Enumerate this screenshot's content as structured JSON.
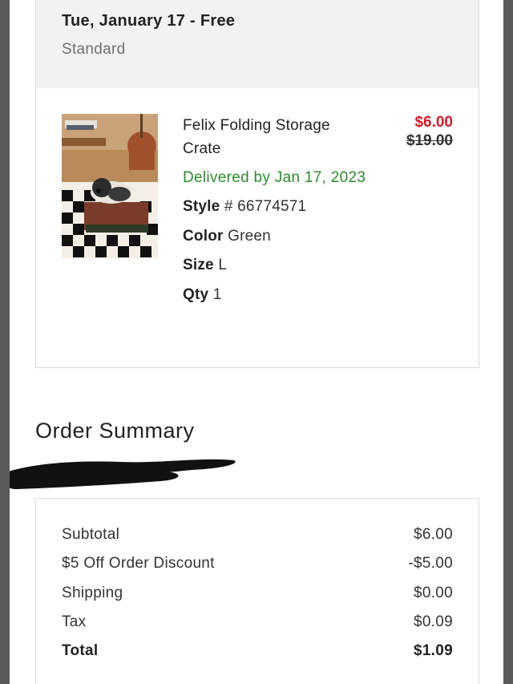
{
  "shipping": {
    "date_label": "Tue, January 17 - Free",
    "method": "Standard"
  },
  "item": {
    "name": "Felix Folding Storage Crate",
    "delivery": "Delivered by Jan 17, 2023",
    "style_label": "Style",
    "style_value": "# 66774571",
    "color_label": "Color",
    "color_value": "Green",
    "size_label": "Size",
    "size_value": "L",
    "qty_label": "Qty",
    "qty_value": "1",
    "price_sale": "$6.00",
    "price_original": "$19.00"
  },
  "summary": {
    "title": "Order Summary",
    "rows": [
      {
        "label": "Subtotal",
        "value": "$6.00"
      },
      {
        "label": "$5 Off Order Discount",
        "value": "-$5.00"
      },
      {
        "label": "Shipping",
        "value": "$0.00"
      },
      {
        "label": "Tax",
        "value": "$0.09"
      },
      {
        "label": "Total",
        "value": "$1.09"
      }
    ]
  },
  "colors": {
    "sale_red": "#c8202a",
    "delivery_green": "#2e8b2e",
    "panel_gray": "#f2f2f2"
  }
}
